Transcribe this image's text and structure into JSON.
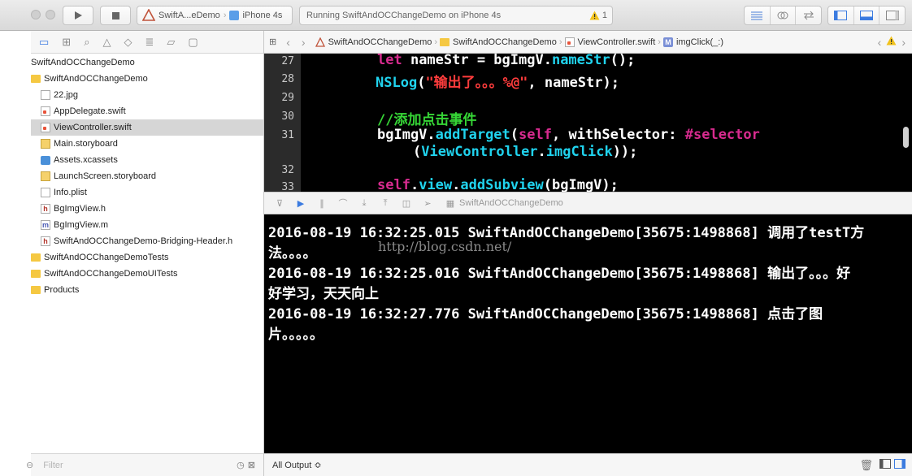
{
  "toolbar": {
    "scheme_name": "SwiftA...eDemo",
    "device": "iPhone 4s",
    "activity": "Running SwiftAndOCChangeDemo on iPhone 4s",
    "warning_count": "1"
  },
  "navigator": {
    "items": [
      {
        "label": "SwiftAndOCChangeDemo",
        "icon": "project-icon",
        "indent": 0
      },
      {
        "label": "SwiftAndOCChangeDemo",
        "icon": "folder-icon",
        "indent": 1
      },
      {
        "label": "22.jpg",
        "icon": "image-file-icon",
        "indent": 2
      },
      {
        "label": "AppDelegate.swift",
        "icon": "swift-file-icon",
        "indent": 2
      },
      {
        "label": "ViewController.swift",
        "icon": "swift-file-icon",
        "indent": 2,
        "selected": true
      },
      {
        "label": "Main.storyboard",
        "icon": "storyboard-icon",
        "indent": 2
      },
      {
        "label": "Assets.xcassets",
        "icon": "assets-icon",
        "indent": 2
      },
      {
        "label": "LaunchScreen.storyboard",
        "icon": "storyboard-icon",
        "indent": 2
      },
      {
        "label": "Info.plist",
        "icon": "plist-icon",
        "indent": 2
      },
      {
        "label": "BgImgView.h",
        "icon": "header-file-icon",
        "indent": 2
      },
      {
        "label": "BgImgView.m",
        "icon": "objc-file-icon",
        "indent": 2
      },
      {
        "label": "SwiftAndOCChangeDemo-Bridging-Header.h",
        "icon": "header-file-icon",
        "indent": 2
      },
      {
        "label": "SwiftAndOCChangeDemoTests",
        "icon": "folder-icon",
        "indent": 1
      },
      {
        "label": "SwiftAndOCChangeDemoUITests",
        "icon": "folder-icon",
        "indent": 1
      },
      {
        "label": "Products",
        "icon": "folder-icon",
        "indent": 1
      }
    ],
    "filter_placeholder": "Filter"
  },
  "jumpbar": {
    "project": "SwiftAndOCChangeDemo",
    "group": "SwiftAndOCChangeDemo",
    "file": "ViewController.swift",
    "symbol": "imgClick(_:)"
  },
  "editor": {
    "line_numbers": [
      "27",
      "28",
      "29",
      "30",
      "31",
      "32",
      "33"
    ]
  },
  "debug": {
    "target": "SwiftAndOCChangeDemo"
  },
  "console": {
    "lines": [
      "2016-08-19 16:32:25.015 SwiftAndOCChangeDemo[35675:1498868] 调用了testT方",
      "法。。。。",
      "2016-08-19 16:32:25.016 SwiftAndOCChangeDemo[35675:1498868] 输出了。。。好",
      "好学习，天天向上",
      "2016-08-19 16:32:27.776 SwiftAndOCChangeDemo[35675:1498868] 点击了图",
      "片。。。。。"
    ],
    "watermark": "http://blog.csdn.net/",
    "output_selector": "All Output ≎"
  },
  "colors": {
    "keyword": "#d82b8f",
    "identifier": "#20d3ee",
    "string": "#ff3c3c",
    "comment": "#36d636",
    "accent": "#3b7be0"
  }
}
